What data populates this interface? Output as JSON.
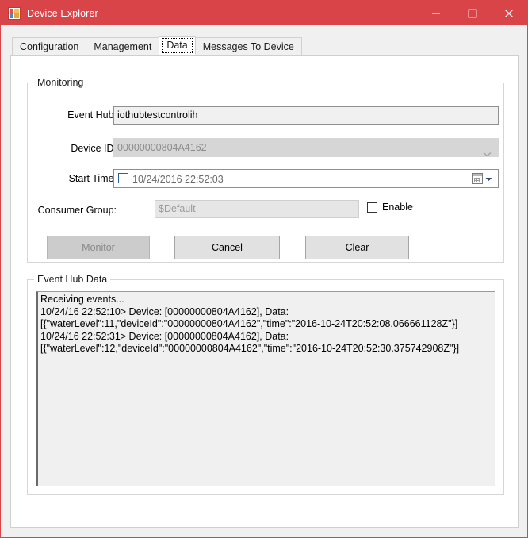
{
  "window": {
    "title": "Device Explorer",
    "icon": "app-window-icon",
    "accent_color": "#d94449",
    "controls": [
      {
        "name": "minimize",
        "glyph": "minimize-icon"
      },
      {
        "name": "maximize",
        "glyph": "maximize-icon"
      },
      {
        "name": "close",
        "glyph": "close-icon"
      }
    ]
  },
  "tabs": [
    {
      "label": "Configuration",
      "selected": false
    },
    {
      "label": "Management",
      "selected": false
    },
    {
      "label": "Data",
      "selected": true
    },
    {
      "label": "Messages To Device",
      "selected": false
    }
  ],
  "monitoring": {
    "group_title": "Monitoring",
    "event_hub": {
      "label": "Event Hub:",
      "value": "iothubtestcontrolih",
      "placeholder": "",
      "disabled": false
    },
    "device_id": {
      "label": "Device ID:",
      "value": "00000000804A4162",
      "disabled": true,
      "dropdown_icon": "chevron-down-icon"
    },
    "start_time": {
      "label": "Start Time:",
      "value": "10/24/2016 22:52:03",
      "checked": false,
      "calendar_icon": "calendar-icon",
      "dropdown_icon": "chevron-down-icon"
    },
    "consumer_group": {
      "label": "Consumer Group:",
      "value": "$Default",
      "disabled": true
    },
    "enable_checkbox": {
      "label": "Enable",
      "checked": false
    },
    "buttons": [
      {
        "label": "Monitor",
        "disabled": true
      },
      {
        "label": "Cancel",
        "disabled": false
      },
      {
        "label": "Clear",
        "disabled": false
      }
    ]
  },
  "event_hub_data": {
    "group_title": "Event Hub Data",
    "lines": [
      "Receiving events...",
      "10/24/16 22:52:10> Device: [00000000804A4162], Data:",
      "[{\"waterLevel\":11,\"deviceId\":\"00000000804A4162\",\"time\":\"2016-10-24T20:52:08.066661128Z\"}]",
      "10/24/16 22:52:31> Device: [00000000804A4162], Data:",
      "[{\"waterLevel\":12,\"deviceId\":\"00000000804A4162\",\"time\":\"2016-10-24T20:52:30.375742908Z\"}]"
    ]
  }
}
